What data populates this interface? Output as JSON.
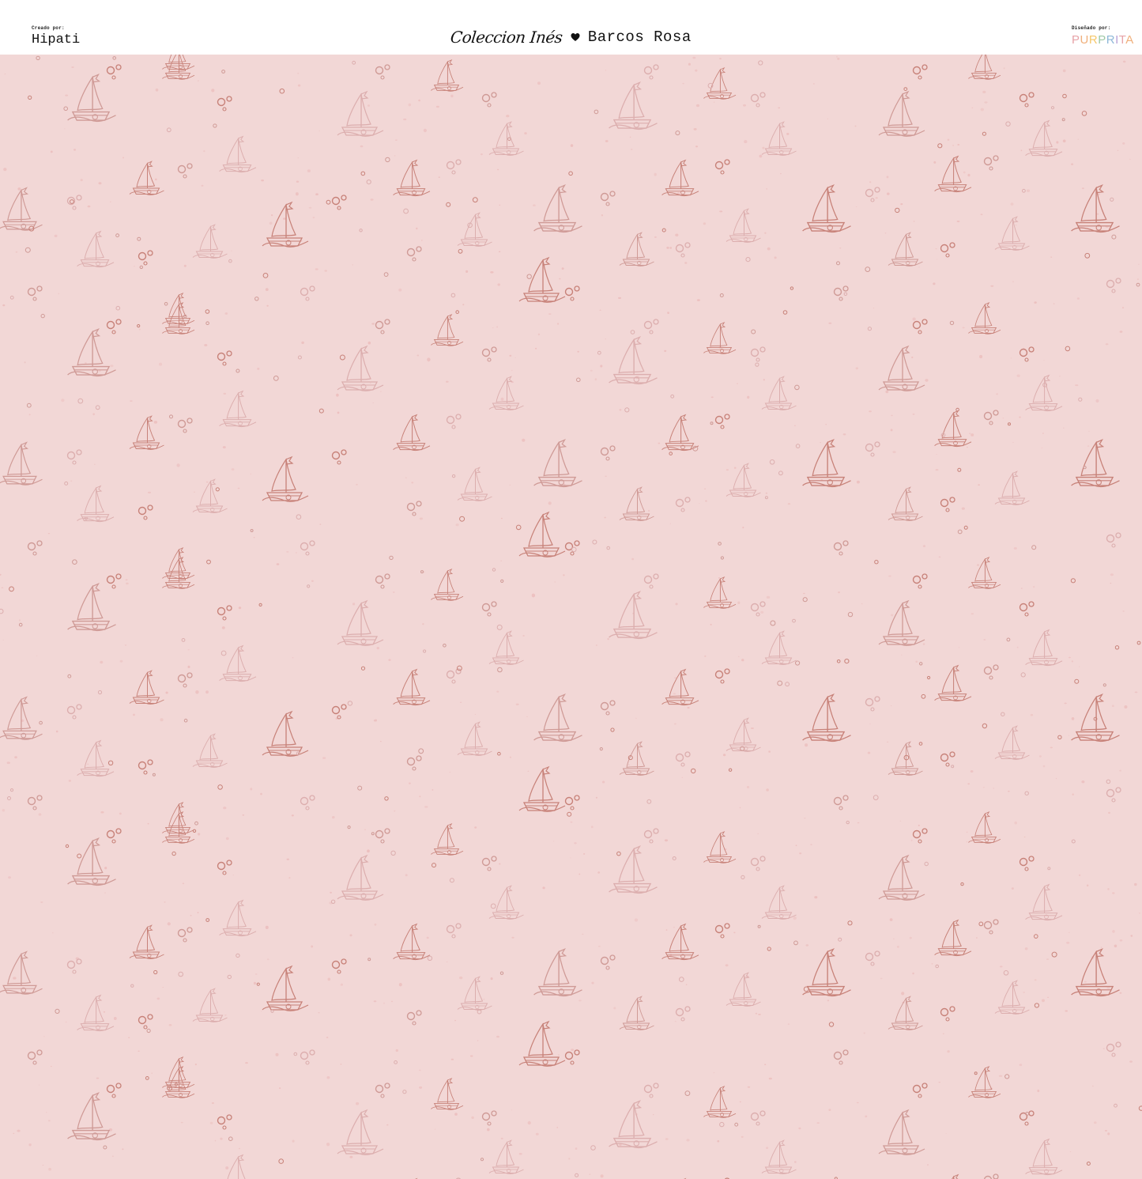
{
  "header": {
    "created_by_label": "Creado por:",
    "creator": "Hipati",
    "collection": "Coleccion Inés",
    "pattern_name": "Barcos Rosa",
    "designed_by_label": "Diseñado por:",
    "designer_logo": "PURPRITA",
    "icons": {
      "separator": "heart-icon"
    }
  },
  "pattern": {
    "motif": "sailboat-outline",
    "secondary_motif": "bubbles",
    "colors": {
      "background": "#f2d7d6",
      "motif_dark": "#c78178",
      "motif_mid": "#cf9a96",
      "motif_light": "#dcaeae",
      "speckle": "#ecc0bf"
    }
  },
  "colors": {
    "header_bg": "#ffffff",
    "text": "#111111",
    "logo_letters": [
      "#e7a3a8",
      "#f0b07c",
      "#f5c86b",
      "#9ec9a6",
      "#8fb8d8",
      "#b8a2d6",
      "#e7a3a8",
      "#f0b07c"
    ]
  }
}
